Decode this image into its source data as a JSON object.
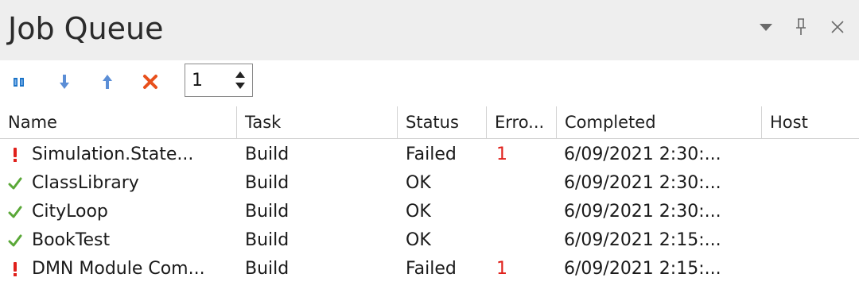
{
  "window": {
    "title": "Job Queue",
    "controls": [
      "dropdown-icon",
      "pin-icon",
      "close-icon"
    ]
  },
  "toolbar": {
    "buttons": [
      "pause-icon",
      "move-down-icon",
      "move-up-icon",
      "delete-icon"
    ],
    "spinner_value": "1"
  },
  "columns": [
    "Name",
    "Task",
    "Status",
    "Erro...",
    "Completed",
    "Host"
  ],
  "rows": [
    {
      "icon": "error",
      "name": "Simulation.State...",
      "task": "Build",
      "status": "Failed",
      "errors": "1",
      "completed": "6/09/2021 2:30:...",
      "host": ""
    },
    {
      "icon": "ok",
      "name": "ClassLibrary",
      "task": "Build",
      "status": "OK",
      "errors": "",
      "completed": "6/09/2021 2:30:...",
      "host": ""
    },
    {
      "icon": "ok",
      "name": "CityLoop",
      "task": "Build",
      "status": "OK",
      "errors": "",
      "completed": "6/09/2021 2:30:...",
      "host": ""
    },
    {
      "icon": "ok",
      "name": "BookTest",
      "task": "Build",
      "status": "OK",
      "errors": "",
      "completed": "6/09/2021 2:15:...",
      "host": ""
    },
    {
      "icon": "error",
      "name": "DMN Module Com...",
      "task": "Build",
      "status": "Failed",
      "errors": "1",
      "completed": "6/09/2021 2:15:...",
      "host": ""
    }
  ],
  "colors": {
    "title_bg": "#eeeeee",
    "icon_blue": "#1a73c7",
    "icon_blue_light": "#5b8ed6",
    "delete_red": "#e8501c",
    "error_red": "#e0201b",
    "ok_green": "#5aa838"
  }
}
